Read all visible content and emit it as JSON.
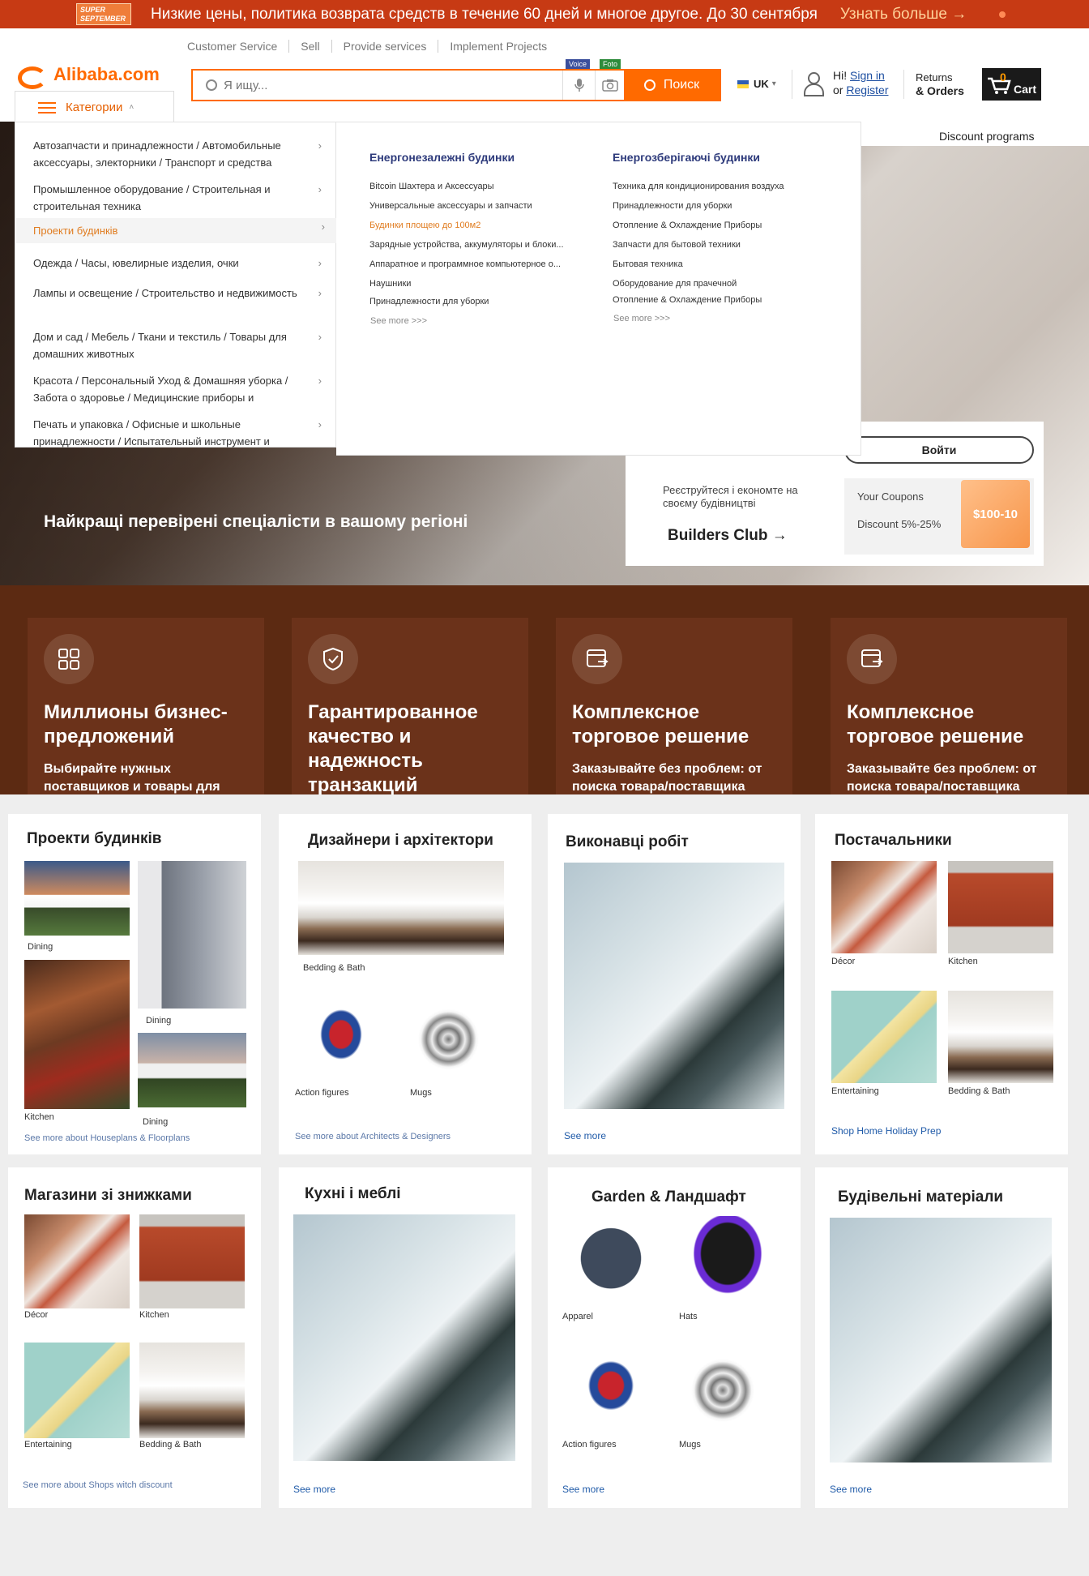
{
  "topbar": {
    "badge_line1": "SUPER",
    "badge_line2": "SEPTEMBER",
    "promo": "Низкие цены, политика возврата средств в течение 60 дней и многое другое. До 30 сентября",
    "more": "Узнать больше →"
  },
  "header": {
    "links": [
      "Customer Service",
      "Sell",
      "Provide services",
      "Implement Projects"
    ],
    "logo": "Alibaba.com",
    "search_placeholder": "Я ищу...",
    "voice_tag": "Voice",
    "foto_tag": "Foto",
    "search_button": "Поиск",
    "lang": "UK",
    "hi": "Hi!",
    "sign_in": "Sign in",
    "or": "or",
    "register": "Register",
    "returns": "Returns",
    "orders": "& Orders",
    "cart_count": "0",
    "cart": "Cart",
    "categories": "Категории"
  },
  "menu": {
    "items": [
      "Автозапчасти и принадлежности / Автомобильные аксессуары, электорники / Транспорт и средства",
      "Промышленное оборудование / Строительная и строительная техника",
      "Проекти будинків",
      "Одежда / Часы, ювелирные изделия, очки",
      "Лампы и освещение / Строительство и недвижимость",
      "Дом и сад / Мебель / Ткани и текстиль / Товары для домашних животных",
      "Красота / Персональный Уход & Домашняя уборка / Забота о здоровье / Медицинские приборы и",
      "Печать и упаковка / Офисные и школьные принадлежности / Испытательный инструмент и"
    ],
    "col1_title": "Енергонезалежні будинки",
    "col1_links": [
      "Bitcoin Шахтера и Аксессуары",
      "Универсальные аксессуары и запчасти",
      "Будинки площею до 100м2",
      "Зарядные устройства, аккумуляторы и блоки...",
      "Аппаратное и программное компьютерное о...",
      "Наушники",
      "Принадлежности для уборки"
    ],
    "col2_title": "Енергозберігаючі будинки",
    "col2_links": [
      "Техника для кондиционирования воздуха",
      "Принадлежности для уборки",
      "Отопление & Охлаждение Приборы",
      "Запчасти для бытовой техники",
      "Бытовая техника",
      "Оборудование для прачечной",
      "Отопление & Охлаждение Приборы"
    ],
    "see_more": "See more >>>"
  },
  "hero": {
    "discount_programs": "Discount programs",
    "title": "Найкращі перевірені спеціалісти в вашому регіоні",
    "login": "Войти",
    "register_text": "Реєструйтеся і економте на своєму будівництві",
    "builders_club": "Builders Club →",
    "coupons": "Your Coupons",
    "discount": "Discount  5%-25%",
    "coupon_img": "$100-10"
  },
  "features": [
    {
      "title": "Миллионы бизнес-предложений",
      "text": "Выбирайте нужных поставщиков и товары для",
      "icon": "grid-icon"
    },
    {
      "title": "Гарантированное качество и надежность транзакций",
      "text": "",
      "icon": "shield-check-icon"
    },
    {
      "title": "Комплексное торговое решение",
      "text": "Заказывайте без проблем: от поиска товара/поставщика",
      "icon": "trade-icon"
    },
    {
      "title": "Комплексное торговое решение",
      "text": "Заказывайте без проблем: от поиска товара/поставщика",
      "icon": "trade-icon"
    }
  ],
  "cards": {
    "c1": {
      "title": "Проекти будинків",
      "caps": [
        "Dining",
        "Dining",
        "Kitchen",
        "Dining"
      ],
      "more": "See more about Houseplans & Floorplans"
    },
    "c2": {
      "title": "Дизайнери і архітектори",
      "caps": [
        "Bedding & Bath",
        "Action figures",
        "Mugs"
      ],
      "more": "See more about Architects & Designers"
    },
    "c3": {
      "title": "Виконавці робіт",
      "more": "See more"
    },
    "c4": {
      "title": "Постачальники",
      "caps": [
        "Décor",
        "Kitchen",
        "Entertaining",
        "Bedding & Bath"
      ],
      "more": "Shop Home Holiday Prep"
    },
    "c5": {
      "title": "Магазини зі знижками",
      "caps": [
        "Décor",
        "Kitchen",
        "Entertaining",
        "Bedding & Bath"
      ],
      "more": "See more about Shops witch discount"
    },
    "c6": {
      "title": "Кухні і меблі",
      "more": "See more"
    },
    "c7": {
      "title": "Garden  &  Ландшафт",
      "caps": [
        "Apparel",
        "Hats",
        "Action figures",
        "Mugs"
      ],
      "more": "See more"
    },
    "c8": {
      "title": "Будівельні матеріали",
      "more": "See more"
    }
  },
  "colors": {
    "accent": "#ff6a00",
    "topbar": "#c73a14",
    "feature_band": "#5c2a12",
    "link": "#1f5aa8",
    "menu_title": "#2d3a7b"
  }
}
